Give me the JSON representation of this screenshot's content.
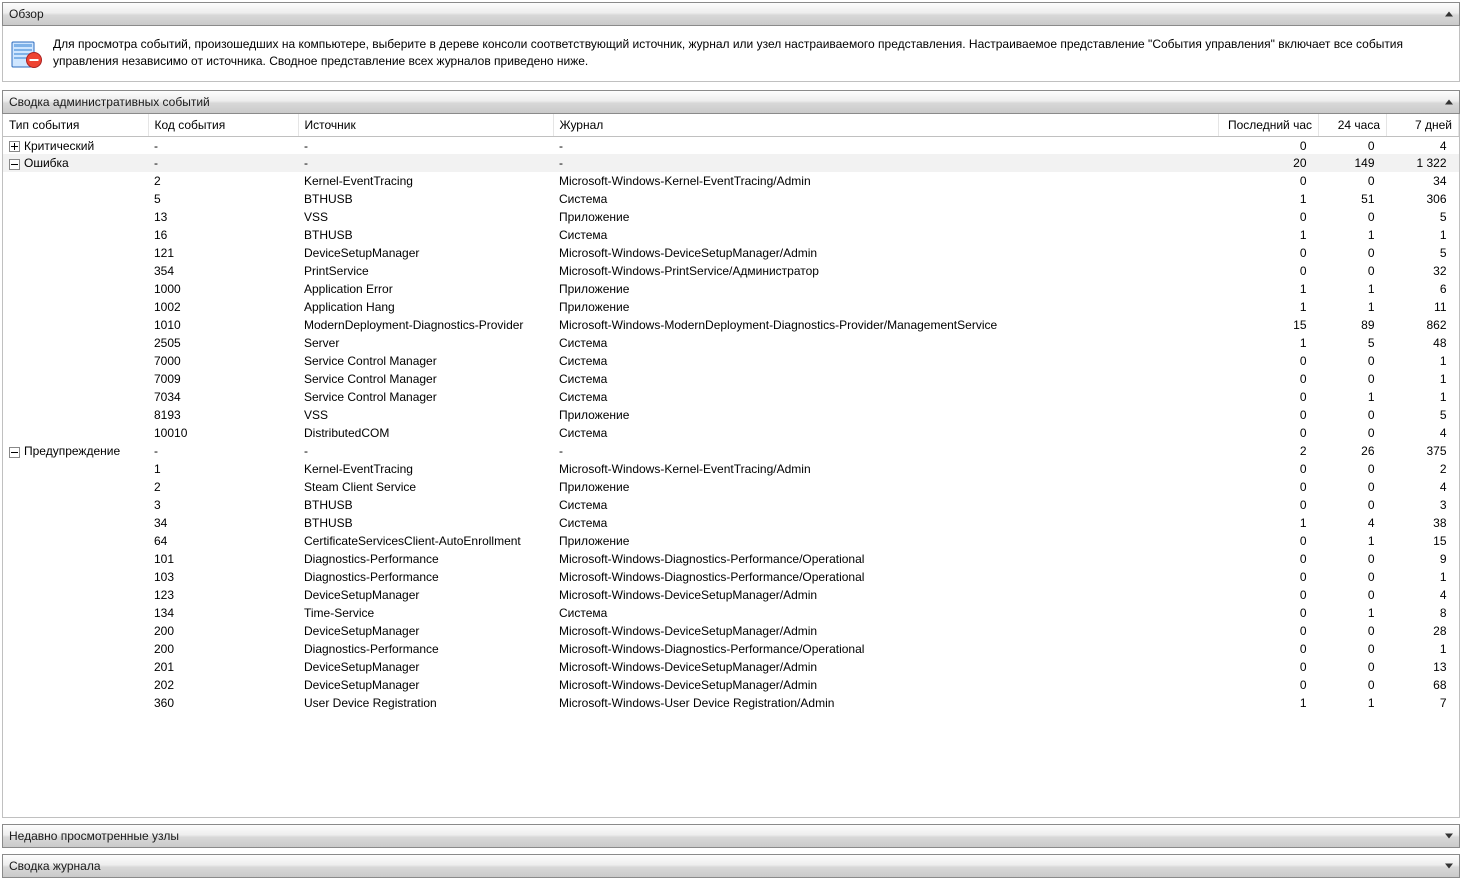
{
  "panels": {
    "overview": {
      "title": "Обзор",
      "infoText": "Для просмотра событий, произошедших на компьютере, выберите в дереве консоли соответствующий источник, журнал или узел настраиваемого представления. Настраиваемое представление \"События управления\" включает все события управления независимо от источника. Сводное представление всех журналов приведено ниже."
    },
    "summary": {
      "title": "Сводка административных событий"
    },
    "recent": {
      "title": "Недавно просмотренные узлы"
    },
    "journalSummary": {
      "title": "Сводка журнала"
    }
  },
  "table": {
    "columns": {
      "type": "Тип события",
      "code": "Код события",
      "source": "Источник",
      "journal": "Журнал",
      "lastHour": "Последний час",
      "h24": "24 часа",
      "d7": "7 дней"
    },
    "categories": [
      {
        "name": "Критический",
        "expanded": false,
        "highlight": false,
        "totals": {
          "code": "-",
          "source": "-",
          "journal": "-",
          "lastHour": "0",
          "h24": "0",
          "d7": "4"
        },
        "rows": []
      },
      {
        "name": "Ошибка",
        "expanded": true,
        "highlight": true,
        "totals": {
          "code": "-",
          "source": "-",
          "journal": "-",
          "lastHour": "20",
          "h24": "149",
          "d7": "1 322"
        },
        "rows": [
          {
            "code": "2",
            "source": "Kernel-EventTracing",
            "journal": "Microsoft-Windows-Kernel-EventTracing/Admin",
            "lastHour": "0",
            "h24": "0",
            "d7": "34"
          },
          {
            "code": "5",
            "source": "BTHUSB",
            "journal": "Система",
            "lastHour": "1",
            "h24": "51",
            "d7": "306"
          },
          {
            "code": "13",
            "source": "VSS",
            "journal": "Приложение",
            "lastHour": "0",
            "h24": "0",
            "d7": "5"
          },
          {
            "code": "16",
            "source": "BTHUSB",
            "journal": "Система",
            "lastHour": "1",
            "h24": "1",
            "d7": "1"
          },
          {
            "code": "121",
            "source": "DeviceSetupManager",
            "journal": "Microsoft-Windows-DeviceSetupManager/Admin",
            "lastHour": "0",
            "h24": "0",
            "d7": "5"
          },
          {
            "code": "354",
            "source": "PrintService",
            "journal": "Microsoft-Windows-PrintService/Администратор",
            "lastHour": "0",
            "h24": "0",
            "d7": "32"
          },
          {
            "code": "1000",
            "source": "Application Error",
            "journal": "Приложение",
            "lastHour": "1",
            "h24": "1",
            "d7": "6"
          },
          {
            "code": "1002",
            "source": "Application Hang",
            "journal": "Приложение",
            "lastHour": "1",
            "h24": "1",
            "d7": "11"
          },
          {
            "code": "1010",
            "source": "ModernDeployment-Diagnostics-Provider",
            "journal": "Microsoft-Windows-ModernDeployment-Diagnostics-Provider/ManagementService",
            "lastHour": "15",
            "h24": "89",
            "d7": "862"
          },
          {
            "code": "2505",
            "source": "Server",
            "journal": "Система",
            "lastHour": "1",
            "h24": "5",
            "d7": "48"
          },
          {
            "code": "7000",
            "source": "Service Control Manager",
            "journal": "Система",
            "lastHour": "0",
            "h24": "0",
            "d7": "1"
          },
          {
            "code": "7009",
            "source": "Service Control Manager",
            "journal": "Система",
            "lastHour": "0",
            "h24": "0",
            "d7": "1"
          },
          {
            "code": "7034",
            "source": "Service Control Manager",
            "journal": "Система",
            "lastHour": "0",
            "h24": "1",
            "d7": "1"
          },
          {
            "code": "8193",
            "source": "VSS",
            "journal": "Приложение",
            "lastHour": "0",
            "h24": "0",
            "d7": "5"
          },
          {
            "code": "10010",
            "source": "DistributedCOM",
            "journal": "Система",
            "lastHour": "0",
            "h24": "0",
            "d7": "4"
          }
        ]
      },
      {
        "name": "Предупреждение",
        "expanded": true,
        "highlight": false,
        "totals": {
          "code": "-",
          "source": "-",
          "journal": "-",
          "lastHour": "2",
          "h24": "26",
          "d7": "375"
        },
        "rows": [
          {
            "code": "1",
            "source": "Kernel-EventTracing",
            "journal": "Microsoft-Windows-Kernel-EventTracing/Admin",
            "lastHour": "0",
            "h24": "0",
            "d7": "2"
          },
          {
            "code": "2",
            "source": "Steam Client Service",
            "journal": "Приложение",
            "lastHour": "0",
            "h24": "0",
            "d7": "4"
          },
          {
            "code": "3",
            "source": "BTHUSB",
            "journal": "Система",
            "lastHour": "0",
            "h24": "0",
            "d7": "3"
          },
          {
            "code": "34",
            "source": "BTHUSB",
            "journal": "Система",
            "lastHour": "1",
            "h24": "4",
            "d7": "38"
          },
          {
            "code": "64",
            "source": "CertificateServicesClient-AutoEnrollment",
            "journal": "Приложение",
            "lastHour": "0",
            "h24": "1",
            "d7": "15"
          },
          {
            "code": "101",
            "source": "Diagnostics-Performance",
            "journal": "Microsoft-Windows-Diagnostics-Performance/Operational",
            "lastHour": "0",
            "h24": "0",
            "d7": "9"
          },
          {
            "code": "103",
            "source": "Diagnostics-Performance",
            "journal": "Microsoft-Windows-Diagnostics-Performance/Operational",
            "lastHour": "0",
            "h24": "0",
            "d7": "1"
          },
          {
            "code": "123",
            "source": "DeviceSetupManager",
            "journal": "Microsoft-Windows-DeviceSetupManager/Admin",
            "lastHour": "0",
            "h24": "0",
            "d7": "4"
          },
          {
            "code": "134",
            "source": "Time-Service",
            "journal": "Система",
            "lastHour": "0",
            "h24": "1",
            "d7": "8"
          },
          {
            "code": "200",
            "source": "DeviceSetupManager",
            "journal": "Microsoft-Windows-DeviceSetupManager/Admin",
            "lastHour": "0",
            "h24": "0",
            "d7": "28"
          },
          {
            "code": "200",
            "source": "Diagnostics-Performance",
            "journal": "Microsoft-Windows-Diagnostics-Performance/Operational",
            "lastHour": "0",
            "h24": "0",
            "d7": "1"
          },
          {
            "code": "201",
            "source": "DeviceSetupManager",
            "journal": "Microsoft-Windows-DeviceSetupManager/Admin",
            "lastHour": "0",
            "h24": "0",
            "d7": "13"
          },
          {
            "code": "202",
            "source": "DeviceSetupManager",
            "journal": "Microsoft-Windows-DeviceSetupManager/Admin",
            "lastHour": "0",
            "h24": "0",
            "d7": "68"
          },
          {
            "code": "360",
            "source": "User Device Registration",
            "journal": "Microsoft-Windows-User Device Registration/Admin",
            "lastHour": "1",
            "h24": "1",
            "d7": "7"
          }
        ]
      }
    ]
  }
}
